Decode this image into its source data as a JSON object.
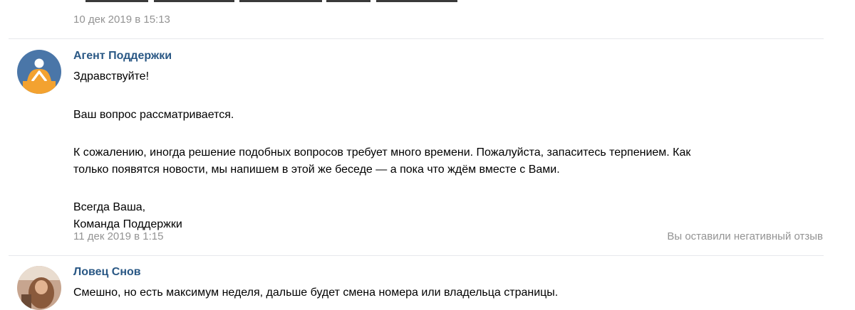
{
  "prev_message": {
    "time": "10 дек 2019 в 15:13"
  },
  "messages": [
    {
      "author": "Агент Поддержки",
      "lines": [
        "Здравствуйте!",
        "Ваш вопрос рассматривается.",
        "К сожалению, иногда решение подобных вопросов требует много времени. Пожалуйста, запаситесь терпением. Как",
        "только появятся новости, мы напишем в этой же беседе — а пока что ждём вместе с Вами.",
        "Всегда Ваша,",
        "Команда Поддержки"
      ],
      "time": "11 дек 2019 в 1:15",
      "status": "Вы оставили негативный отзыв",
      "avatar_colors": {
        "bg": "#4a76a8",
        "figure": "#f3a230"
      }
    },
    {
      "author": "Ловец Снов",
      "lines": [
        "Смешно, но есть максимум неделя, дальше будет смена номера или владельца страницы."
      ]
    }
  ],
  "colors": {
    "link": "#2a5885",
    "meta": "#939393",
    "divider": "#e7e8ec"
  }
}
